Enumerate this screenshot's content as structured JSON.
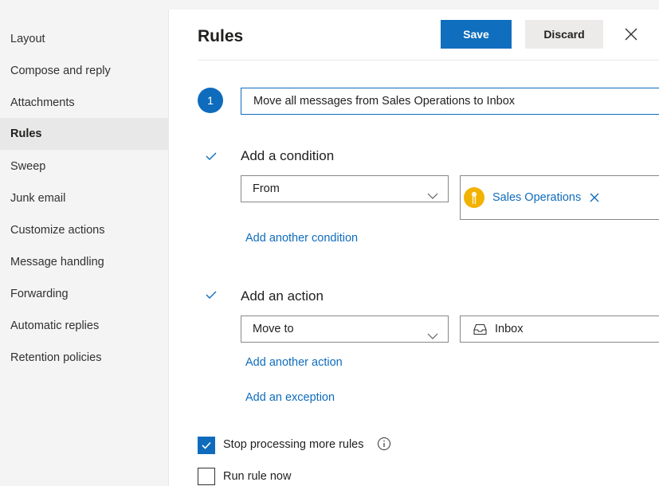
{
  "sidebar": {
    "items": [
      {
        "label": "Layout"
      },
      {
        "label": "Compose and reply"
      },
      {
        "label": "Attachments"
      },
      {
        "label": "Rules"
      },
      {
        "label": "Sweep"
      },
      {
        "label": "Junk email"
      },
      {
        "label": "Customize actions"
      },
      {
        "label": "Message handling"
      },
      {
        "label": "Forwarding"
      },
      {
        "label": "Automatic replies"
      },
      {
        "label": "Retention policies"
      }
    ],
    "active": "Rules"
  },
  "header": {
    "title": "Rules",
    "save_label": "Save",
    "discard_label": "Discard",
    "close_icon": "close-icon"
  },
  "rule": {
    "step_number": "1",
    "name_value": "Move all messages from Sales Operations to Inbox"
  },
  "condition": {
    "title": "Add a condition",
    "dropdown_value": "From",
    "person_name": "Sales Operations",
    "add_another_label": "Add another condition"
  },
  "action": {
    "title": "Add an action",
    "dropdown_value": "Move to",
    "folder_name": "Inbox",
    "add_another_label": "Add another action",
    "add_exception_label": "Add an exception"
  },
  "options": {
    "stop_processing_label": "Stop processing more rules",
    "stop_processing_checked": true,
    "run_now_label": "Run rule now",
    "run_now_checked": false
  },
  "colors": {
    "accent": "#0f6cbd",
    "sidebar_bg": "#f4f4f4",
    "avatar": "#f2b200"
  }
}
